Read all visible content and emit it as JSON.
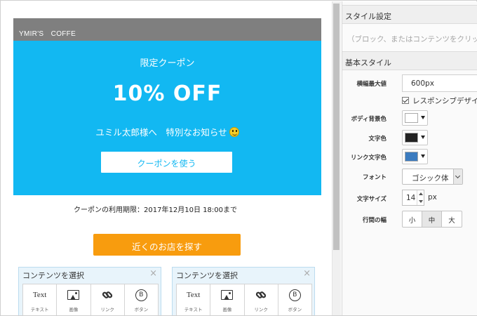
{
  "email": {
    "header_text": "YMIR'S　COFFE",
    "banner": {
      "label": "限定クーポン",
      "headline": "10% OFF",
      "message": "ユミル太郎様へ　特別なお知らせ",
      "coupon_button": "クーポンを使う",
      "bg_color": "#12b8f2"
    },
    "expiry_text": "クーポンの利用期限：2017年12月10日 18:00まで",
    "store_button": "近くのお店を探す",
    "store_button_color": "#f89c0e"
  },
  "content_selectors": [
    {
      "title": "コンテンツを選択",
      "close": "×",
      "tools": [
        {
          "icon": "text-icon",
          "icon_text": "Text",
          "label": "テキスト"
        },
        {
          "icon": "image-icon",
          "label": "画像"
        },
        {
          "icon": "link-icon",
          "label": "リンク"
        },
        {
          "icon": "button-icon",
          "icon_text": "B",
          "label": "ボタン"
        }
      ]
    },
    {
      "title": "コンテンツを選択",
      "close": "×",
      "tools": [
        {
          "icon": "text-icon",
          "icon_text": "Text",
          "label": "テキスト"
        },
        {
          "icon": "image-icon",
          "label": "画像"
        },
        {
          "icon": "link-icon",
          "label": "リンク"
        },
        {
          "icon": "button-icon",
          "icon_text": "B",
          "label": "ボタン"
        }
      ]
    }
  ],
  "panel": {
    "style_settings_title": "スタイル設定",
    "hint": "（ブロック、またはコンテンツをクリック",
    "basic_style_title": "基本スタイル",
    "max_width": {
      "label": "横幅最大値",
      "value": "600px"
    },
    "responsive": {
      "label": "レスポンシブデザイ",
      "checked": true
    },
    "body_bg": {
      "label": "ボディ背景色",
      "color": "#ffffff"
    },
    "text_color": {
      "label": "文字色",
      "color": "#222222"
    },
    "link_color": {
      "label": "リンク文字色",
      "color": "#3b7bbf"
    },
    "font": {
      "label": "フォント",
      "value": "ゴシック体"
    },
    "font_size": {
      "label": "文字サイズ",
      "value": "14",
      "unit": "px"
    },
    "line_height": {
      "label": "行間の幅",
      "options": [
        "小",
        "中",
        "大"
      ],
      "selected": "中"
    }
  }
}
